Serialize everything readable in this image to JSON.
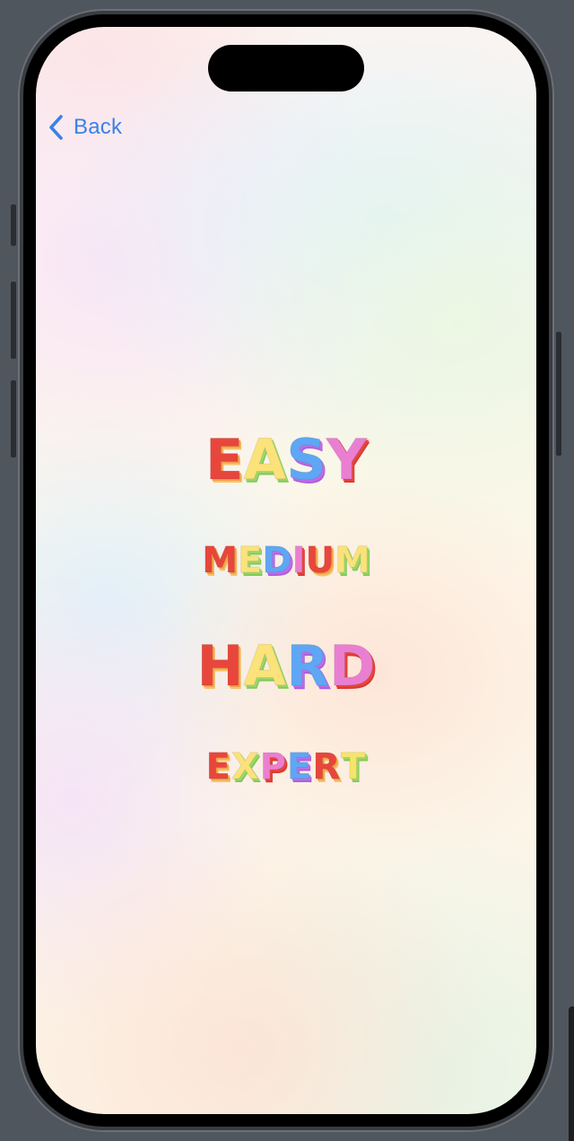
{
  "navigation": {
    "back_label": "Back",
    "back_icon": "chevron-left-icon",
    "accent_color": "#3b82e6"
  },
  "difficulties": [
    {
      "id": "easy",
      "label": "EASY",
      "letters": [
        "E",
        "A",
        "S",
        "Y"
      ]
    },
    {
      "id": "medium",
      "label": "MEDIUM",
      "letters": [
        "M",
        "E",
        "D",
        "I",
        "U",
        "M"
      ]
    },
    {
      "id": "hard",
      "label": "HARD",
      "letters": [
        "H",
        "A",
        "R",
        "D"
      ]
    },
    {
      "id": "expert",
      "label": "EXPERT",
      "letters": [
        "E",
        "X",
        "P",
        "E",
        "R",
        "T"
      ]
    }
  ],
  "letter_colors": {
    "red": "#e8463c",
    "yellow": "#fbe27a",
    "blue": "#5fa6f5",
    "pink": "#ea7fd2"
  }
}
